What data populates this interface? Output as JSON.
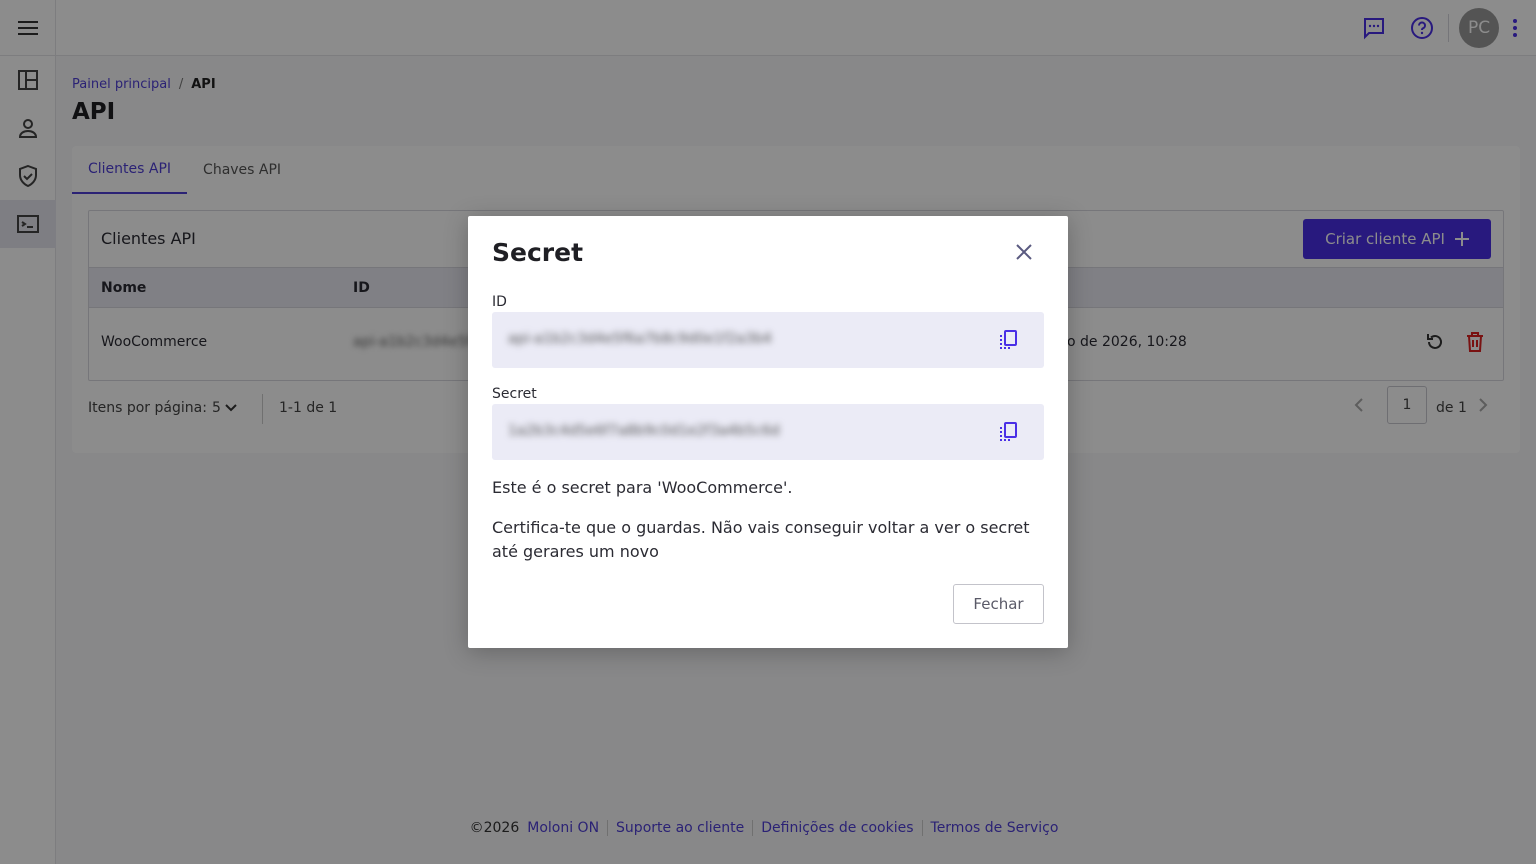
{
  "topbar": {
    "menu_icon": "menu-icon",
    "chat_icon": "chat-icon",
    "help_icon": "help-icon",
    "avatar_initials": "PC",
    "more_icon": "more-vertical-icon",
    "accent_color": "#4f3fd6"
  },
  "sidebar": {
    "items": [
      {
        "icon": "dashboard-icon"
      },
      {
        "icon": "user-icon"
      },
      {
        "icon": "shield-check-icon"
      },
      {
        "icon": "terminal-icon",
        "active": true
      }
    ]
  },
  "breadcrumb": {
    "home": "Painel principal",
    "separator": "/",
    "current": "API"
  },
  "page_title": "API",
  "tabs": [
    {
      "label": "Clientes API",
      "active": true
    },
    {
      "label": "Chaves API",
      "active": false
    }
  ],
  "clients_panel": {
    "title": "Clientes API",
    "create_button": "Criar cliente API",
    "columns": [
      "Nome",
      "ID"
    ],
    "rows": [
      {
        "name": "WooCommerce",
        "id": "api-a1b2c3d4e5f6a7b8c9d0e1f2a3b4",
        "date": "o de 2026, 10:28"
      }
    ]
  },
  "pagination": {
    "items_per_page_label": "Itens por página:",
    "items_per_page_value": "5",
    "range": "1-1 de 1",
    "page": "1",
    "of": "de 1"
  },
  "footer": {
    "copyright": "©2026",
    "links": [
      "Moloni ON",
      "Suporte ao cliente",
      "Definições de cookies",
      "Termos de Serviço"
    ]
  },
  "modal": {
    "title": "Secret",
    "id_label": "ID",
    "id_value": "api-a1b2c3d4e5f6a7b8c9d0e1f2a3b4",
    "secret_label": "Secret",
    "secret_value": "1a2b3c4d5e6f7a8b9c0d1e2f3a4b5c6d",
    "message_1": "Este é o secret para 'WooCommerce'.",
    "message_2": "Certifica-te que o guardas. Não vais conseguir voltar a ver o secret até gerares um novo",
    "close_button": "Fechar"
  }
}
